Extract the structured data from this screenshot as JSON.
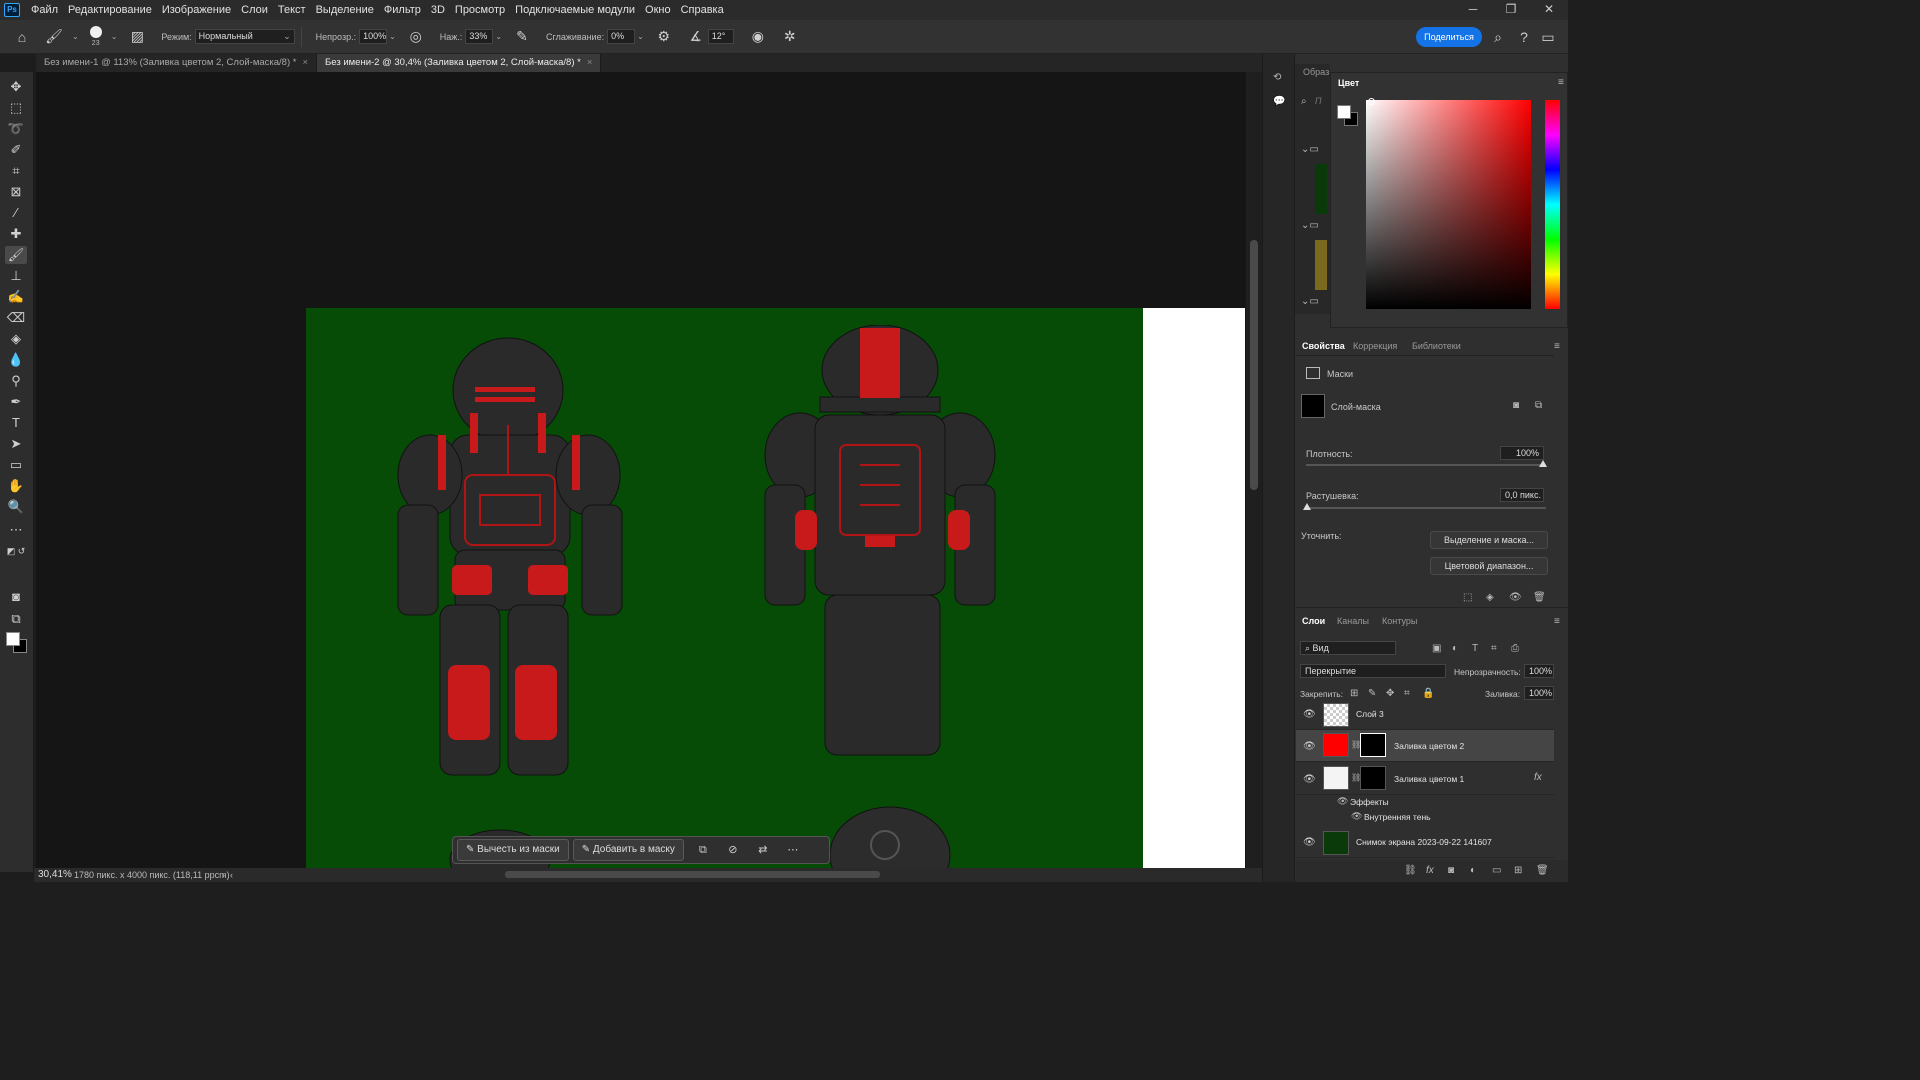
{
  "app": {
    "logo": "Ps"
  },
  "menu": [
    "Файл",
    "Редактирование",
    "Изображение",
    "Слои",
    "Текст",
    "Выделение",
    "Фильтр",
    "3D",
    "Просмотр",
    "Подключаемые модули",
    "Окно",
    "Справка"
  ],
  "window_controls": {
    "minimize": "─",
    "restore": "❐",
    "close": "✕"
  },
  "options": {
    "brush_size": "23",
    "mode_label": "Режим:",
    "mode_value": "Нормальный",
    "opacity_label": "Непрозр.:",
    "opacity_value": "100%",
    "pressure_label": "Наж.:",
    "pressure_value": "33%",
    "smoothing_label": "Сглаживание:",
    "smoothing_value": "0%",
    "angle_value": "12°",
    "share": "Поделиться"
  },
  "tabs": [
    {
      "label": "Без имени-1 @ 113% (Заливка цветом 2, Слой-маска/8) *",
      "active": false
    },
    {
      "label": "Без имени-2 @ 30,4% (Заливка цветом 2, Слой-маска/8) *",
      "active": true
    }
  ],
  "status": {
    "zoom": "30,41%",
    "info": "1780 пикс. x 4000 пикс. (118,11 ppcm)"
  },
  "context_bar": {
    "subtract": "Вычесть из маски",
    "add": "Добавить в маску",
    "more": "⋯"
  },
  "panels": {
    "mini_label": "Образ",
    "mini_search_placeholder": "П",
    "color_tab": "Цвет",
    "properties_tabs": [
      "Свойства",
      "Коррекция",
      "Библиотеки"
    ],
    "masks_label": "Маски",
    "layer_mask_label": "Слой-маска",
    "density_label": "Плотность:",
    "density_value": "100%",
    "feather_label": "Растушевка:",
    "feather_value": "0,0 пикс.",
    "refine_label": "Уточнить:",
    "select_mask_btn": "Выделение и маска...",
    "color_range_btn": "Цветовой диапазон...",
    "layers_tabs": [
      "Слои",
      "Каналы",
      "Контуры"
    ],
    "filter_value": "Вид",
    "blend_value": "Перекрытие",
    "layer_opacity_label": "Непрозрачность:",
    "layer_opacity_value": "100%",
    "lock_label": "Закрепить:",
    "fill_label": "Заливка:",
    "fill_value": "100%"
  },
  "layers": [
    {
      "name": "Слой 3"
    },
    {
      "name": "Заливка цветом 2"
    },
    {
      "name": "Заливка цветом 1",
      "fx": "fx"
    },
    {
      "name": "Эффекты"
    },
    {
      "name": "Внутренняя тень"
    },
    {
      "name": "Снимок экрана 2023-09-22 141607"
    }
  ],
  "colors": {
    "canvas_green": "#064c06",
    "armor_red": "#d01818",
    "accent_blue": "#1473e6"
  }
}
